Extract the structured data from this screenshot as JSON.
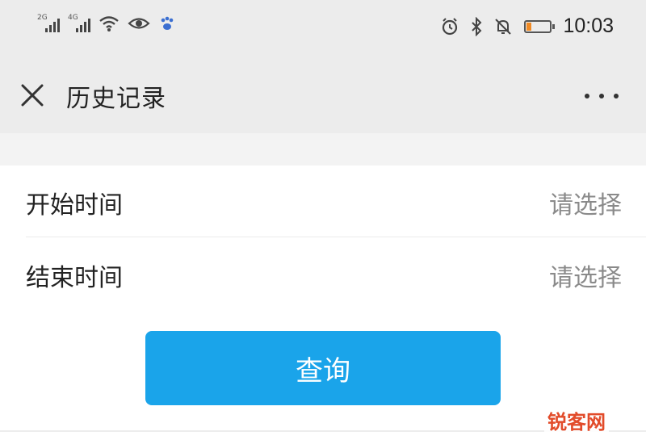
{
  "status_bar": {
    "signal1_tag": "2G",
    "signal2_tag": "4G",
    "time": "10:03",
    "battery_level": 0.2,
    "icons": [
      "signal-icon",
      "signal-icon",
      "wifi-icon",
      "eye-icon",
      "paw-icon",
      "alarm-icon",
      "bluetooth-icon",
      "mute-icon",
      "battery-icon"
    ]
  },
  "navbar": {
    "title": "历史记录",
    "close_icon": "close-icon",
    "more_icon": "more-icon"
  },
  "form": {
    "rows": [
      {
        "label": "开始时间",
        "value": "请选择"
      },
      {
        "label": "结束时间",
        "value": "请选择"
      }
    ],
    "query_button": "查询"
  },
  "watermark": "锐客网",
  "colors": {
    "accent": "#1aa4ea",
    "background": "#efefef",
    "placeholder": "#8a8a8a",
    "watermark": "#e24b2a",
    "battery": "#f08a24"
  }
}
